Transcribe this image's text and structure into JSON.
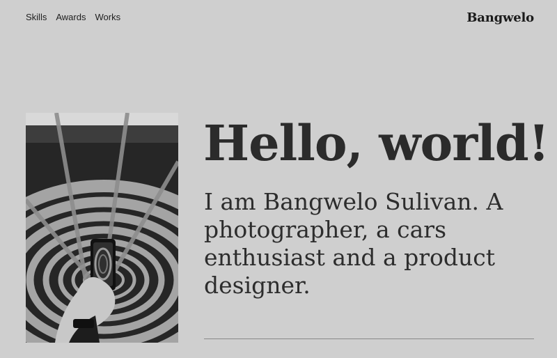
{
  "nav": {
    "items": [
      {
        "label": "Skills"
      },
      {
        "label": "Awards"
      },
      {
        "label": "Works"
      }
    ]
  },
  "brand": {
    "name": "Bangwelo"
  },
  "hero": {
    "headline": "Hello, world!",
    "intro": "I am Bangwelo Sulivan. A photographer, a cars enthusiast and a product designer."
  },
  "image": {
    "icon": "spiral-parking-garage-photo"
  },
  "colors": {
    "background": "#cfcfcf",
    "text": "#2b2b2b"
  }
}
